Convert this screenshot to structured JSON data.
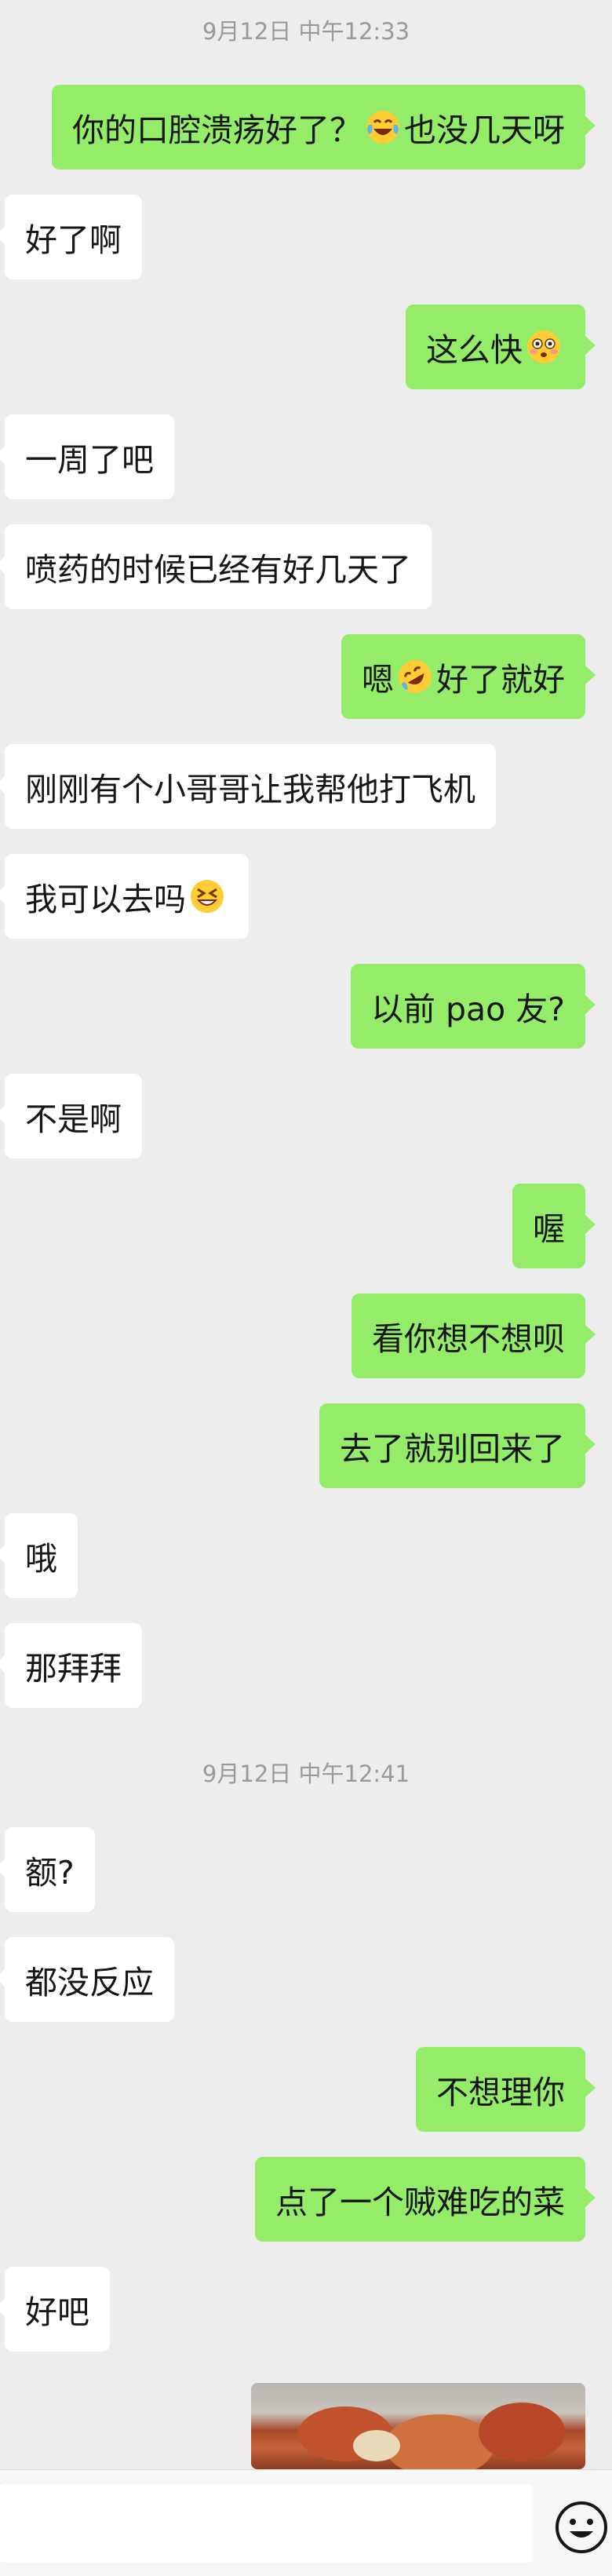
{
  "timestamps": [
    "9月12日 中午12:33",
    "9月12日 中午12:41"
  ],
  "messages": [
    {
      "side": "out",
      "text": "你的口腔溃疡好了？",
      "emoji": "laugh-tears",
      "after": "也没几天呀"
    },
    {
      "side": "in",
      "text": "好了啊"
    },
    {
      "side": "out",
      "text": "这么快",
      "emoji": "flushed"
    },
    {
      "side": "in",
      "text": "一周了吧"
    },
    {
      "side": "in",
      "text": "喷药的时候已经有好几天了"
    },
    {
      "side": "out",
      "text": "嗯",
      "emoji": "rofl",
      "after": "好了就好"
    },
    {
      "side": "in",
      "text": "刚刚有个小哥哥让我帮他打飞机"
    },
    {
      "side": "in",
      "text": "我可以去吗",
      "emoji": "squint-grin"
    },
    {
      "side": "out",
      "text": "以前 pao 友?"
    },
    {
      "side": "in",
      "text": "不是啊"
    },
    {
      "side": "out",
      "text": "喔"
    },
    {
      "side": "out",
      "text": "看你想不想呗"
    },
    {
      "side": "out",
      "text": "去了就别回来了"
    },
    {
      "side": "in",
      "text": "哦"
    },
    {
      "side": "in",
      "text": "那拜拜"
    },
    {
      "side": "in",
      "text": "额?"
    },
    {
      "side": "in",
      "text": "都没反应"
    },
    {
      "side": "out",
      "text": "不想理你"
    },
    {
      "side": "out",
      "text": "点了一个贼难吃的菜"
    },
    {
      "side": "in",
      "text": "好吧"
    }
  ],
  "icons": {
    "photo": "food-photo",
    "input_right": "smile-icon"
  },
  "colors": {
    "background": "#ededed",
    "incoming_bubble": "#ffffff",
    "outgoing_bubble": "#95ec69",
    "timestamp": "#9a9a9a"
  }
}
